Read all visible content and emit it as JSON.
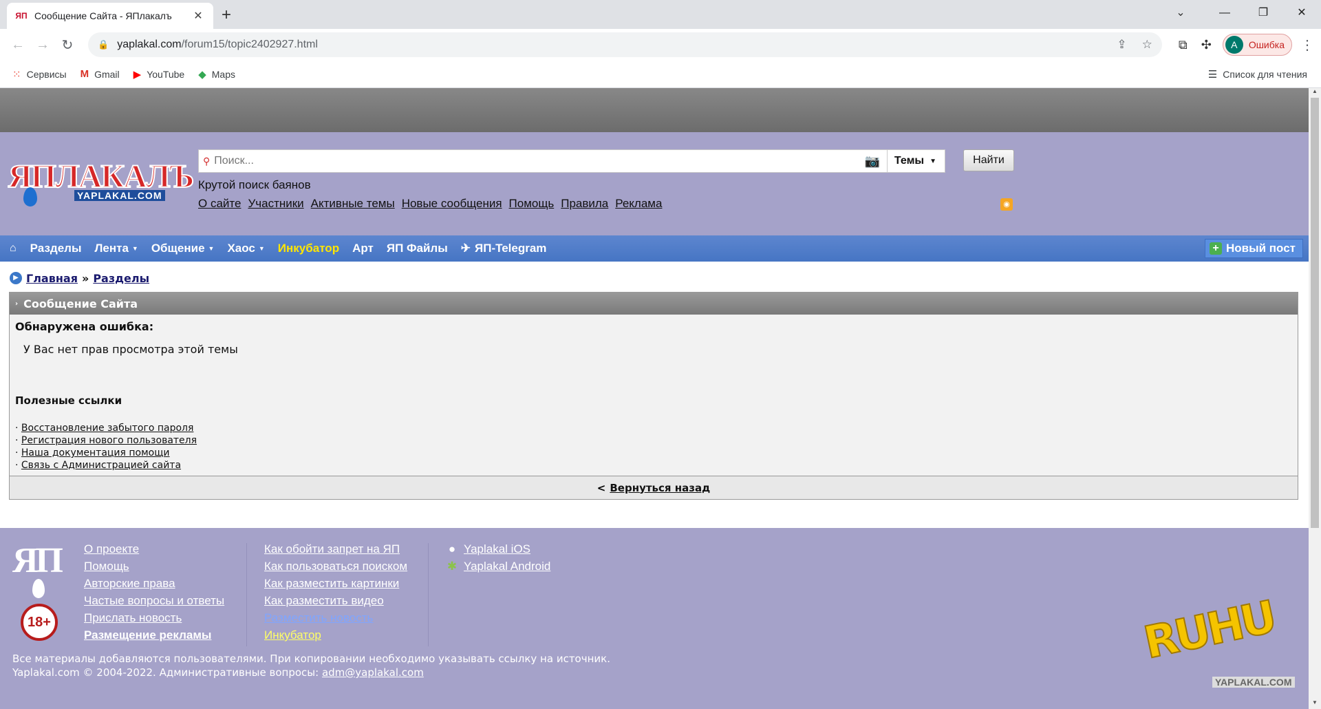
{
  "browser": {
    "tab_title": "Сообщение Сайта - ЯПлакалъ",
    "tab_favicon": "ЯП",
    "new_tab": "+",
    "url_host": "yaplakal.com",
    "url_path": "/forum15/topic2402927.html",
    "profile_initial": "A",
    "profile_status": "Ошибка",
    "bookmarks": [
      {
        "label": "Сервисы",
        "icon": "apps-grid-icon"
      },
      {
        "label": "Gmail",
        "icon": "gmail-icon"
      },
      {
        "label": "YouTube",
        "icon": "youtube-icon"
      },
      {
        "label": "Maps",
        "icon": "maps-icon"
      }
    ],
    "reading_list": "Список для чтения"
  },
  "header": {
    "logo_text": "ЯПЛАКАЛЪ",
    "logo_sub": "YAPLAKAL.COM",
    "search_placeholder": "Поиск...",
    "search_type": "Темы",
    "search_button": "Найти",
    "tagline": "Крутой поиск баянов",
    "links": [
      "О сайте",
      "Участники",
      "Активные темы",
      "Новые сообщения",
      "Помощь",
      "Правила",
      "Реклама"
    ]
  },
  "nav": {
    "items": [
      "Разделы",
      "Лента",
      "Общение",
      "Хаос",
      "Инкубатор",
      "Арт",
      "ЯП Файлы",
      "ЯП-Telegram"
    ],
    "new_post": "Новый пост"
  },
  "breadcrumb": {
    "home": "Главная",
    "sep": "»",
    "section": "Разделы"
  },
  "message": {
    "title": "Сообщение Сайта",
    "error_title": "Обнаружена ошибка:",
    "error_text": "У Вас нет прав просмотра этой темы",
    "links_title": "Полезные ссылки",
    "links": [
      "Восстановление забытого пароля",
      "Регистрация нового пользователя",
      "Наша документация помощи",
      "Связь с Администрацией сайта"
    ],
    "back": "Вернуться назад",
    "back_prefix": "<"
  },
  "footer": {
    "logo": "ЯП",
    "age": "18+",
    "col1": [
      "О проекте",
      "Помощь",
      "Авторские права",
      "Частые вопросы и ответы",
      "Прислать новость",
      "Размещение рекламы"
    ],
    "col2": [
      "Как обойти запрет на ЯП",
      "Как пользоваться поиском",
      "Как разместить картинки",
      "Как разместить видео",
      "Разместить новость",
      "Инкубатор"
    ],
    "col3": [
      "Yaplakal iOS",
      "Yaplakal Android"
    ],
    "copyright_line1": "Все материалы добавляются пользователями. При копировании необходимо указывать ссылку на источник.",
    "copyright_line2": "Yaplakal.com © 2004-2022. Административные вопросы:",
    "email": "adm@yaplakal.com",
    "badge_text": "RUHU",
    "badge_caption": "YAPLAKAL.COM"
  }
}
